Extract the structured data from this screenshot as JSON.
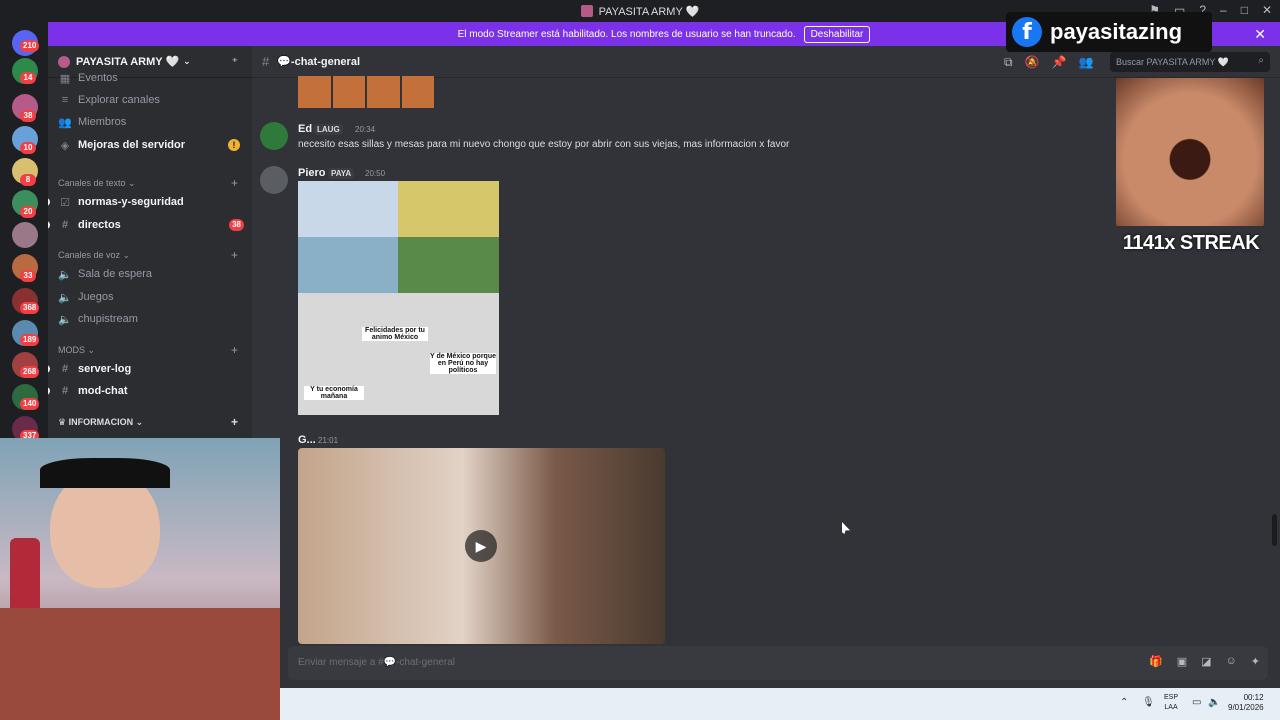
{
  "window": {
    "title": "PAYASITA ARMY 🤍"
  },
  "banner": {
    "text": "El modo Streamer está habilitado. Los nombres de usuario se han truncado.",
    "button": "Deshabilitar"
  },
  "guilds": {
    "badges": [
      "210",
      "14",
      "38",
      "10",
      "8",
      "20",
      "33",
      "368",
      "189",
      "268",
      "140",
      "337"
    ]
  },
  "server": {
    "name": "PAYASITA ARMY 🤍"
  },
  "sidebar": {
    "top_items": [
      {
        "label": "Eventos"
      },
      {
        "label": "Explorar canales"
      },
      {
        "label": "Miembros"
      },
      {
        "label": "Mejoras del servidor"
      }
    ],
    "categories": {
      "text": "Canales de texto",
      "voice": "Canales de voz",
      "mods": "MODS",
      "info": "INFORMACION"
    },
    "text_channels": [
      {
        "label": "normas-y-seguridad"
      },
      {
        "label": "directos",
        "badge": "38"
      }
    ],
    "voice_channels": [
      {
        "label": "Sala de espera"
      },
      {
        "label": "Juegos"
      },
      {
        "label": "chupistream"
      }
    ],
    "mod_channels": [
      {
        "label": "server-log"
      },
      {
        "label": "mod-chat"
      }
    ]
  },
  "chat": {
    "channel": "💬-chat-general",
    "search_placeholder": "Buscar PAYASITA ARMY 🤍",
    "messages": [
      {
        "author": "Ed",
        "tag": "LAUG",
        "time": "20:34",
        "text": "necesito esas sillas y mesas para mi nuevo chongo que estoy por abrir con sus viejas, mas informacion x favor"
      },
      {
        "author": "Piero",
        "tag": "PAYA",
        "time": "20:50",
        "image_captions": [
          "Felicidades por tu animo México",
          "Y de México porque en Perú no hay políticos",
          "Y tu economía mañana"
        ]
      },
      {
        "author": "G...",
        "time": "21:01"
      }
    ],
    "composer_placeholder": "Enviar mensaje a #💬-chat-general"
  },
  "overlay": {
    "facebook_name": "payasitazing",
    "streak": "1141x STREAK"
  },
  "taskbar": {
    "lang_line1": "ESP",
    "lang_line2": "LAA",
    "time": "00:12",
    "date": "9/01/2026"
  }
}
